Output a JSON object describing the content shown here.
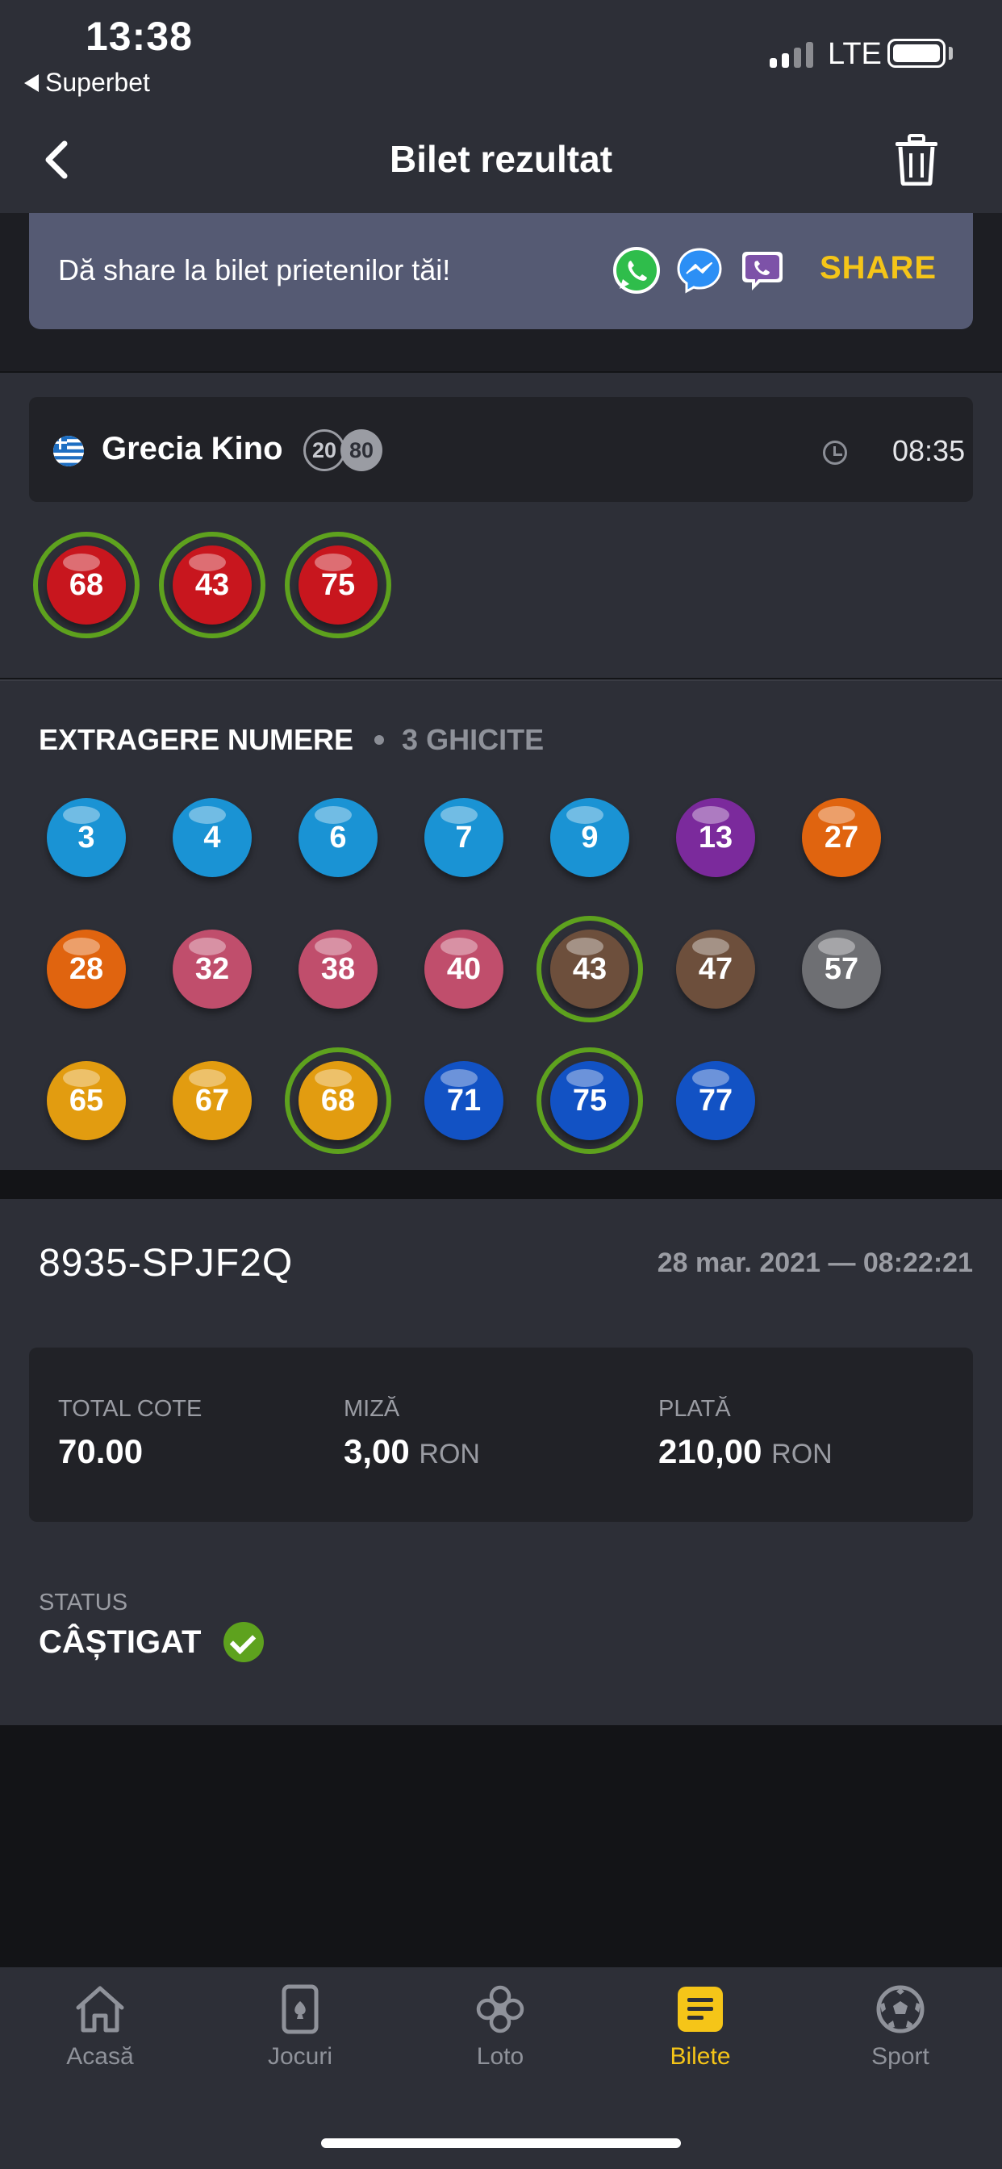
{
  "status_bar": {
    "time": "13:38",
    "back_app": "Superbet",
    "network": "LTE"
  },
  "nav": {
    "title": "Bilet rezultat"
  },
  "share": {
    "text": "Dă share la bilet prietenilor tăi!",
    "button": "SHARE",
    "icons": [
      "whatsapp-icon",
      "messenger-icon",
      "viber-icon"
    ]
  },
  "game": {
    "name": "Grecia Kino",
    "badge_picked": "20",
    "badge_total": "80",
    "time": "08:35"
  },
  "selected_numbers": [
    {
      "n": "68",
      "color": "#c8161e",
      "hit": true
    },
    {
      "n": "43",
      "color": "#c8161e",
      "hit": true
    },
    {
      "n": "75",
      "color": "#c8161e",
      "hit": true
    }
  ],
  "draw": {
    "title": "EXTRAGERE NUMERE",
    "subtitle": "3 GHICITE",
    "numbers": [
      {
        "n": "3",
        "color": "#1a93d4",
        "hit": false
      },
      {
        "n": "4",
        "color": "#1a93d4",
        "hit": false
      },
      {
        "n": "6",
        "color": "#1a93d4",
        "hit": false
      },
      {
        "n": "7",
        "color": "#1a93d4",
        "hit": false
      },
      {
        "n": "9",
        "color": "#1a93d4",
        "hit": false
      },
      {
        "n": "13",
        "color": "#7b2a9c",
        "hit": false
      },
      {
        "n": "27",
        "color": "#e0640f",
        "hit": false
      },
      {
        "n": "28",
        "color": "#e0640f",
        "hit": false
      },
      {
        "n": "32",
        "color": "#c04e6c",
        "hit": false
      },
      {
        "n": "38",
        "color": "#c04e6c",
        "hit": false
      },
      {
        "n": "40",
        "color": "#c04e6c",
        "hit": false
      },
      {
        "n": "43",
        "color": "#6d4f3c",
        "hit": true
      },
      {
        "n": "47",
        "color": "#6d4f3c",
        "hit": false
      },
      {
        "n": "57",
        "color": "#6e6f73",
        "hit": false
      },
      {
        "n": "65",
        "color": "#e29c10",
        "hit": false
      },
      {
        "n": "67",
        "color": "#e29c10",
        "hit": false
      },
      {
        "n": "68",
        "color": "#e29c10",
        "hit": true
      },
      {
        "n": "71",
        "color": "#1252c4",
        "hit": false
      },
      {
        "n": "75",
        "color": "#1252c4",
        "hit": true
      },
      {
        "n": "77",
        "color": "#1252c4",
        "hit": false
      }
    ]
  },
  "ticket": {
    "id": "8935-SPJF2Q",
    "date": "28 mar. 2021 — 08:22:21",
    "total_cote_label": "TOTAL COTE",
    "total_cote_value": "70.00",
    "miza_label": "MIZĂ",
    "miza_value": "3,00",
    "plata_label": "PLATĂ",
    "plata_value": "210,00",
    "currency": "RON",
    "status_label": "STATUS",
    "status_value": "CÂȘTIGAT"
  },
  "tabs": [
    {
      "label": "Acasă",
      "icon": "home-icon",
      "active": false
    },
    {
      "label": "Jocuri",
      "icon": "cards-icon",
      "active": false
    },
    {
      "label": "Loto",
      "icon": "clover-icon",
      "active": false
    },
    {
      "label": "Bilete",
      "icon": "ticket-icon",
      "active": true
    },
    {
      "label": "Sport",
      "icon": "soccer-ball-icon",
      "active": false
    }
  ],
  "colors": {
    "accent": "#f5c518",
    "hit_ring": "#5ea21e",
    "panel": "#2d2f37",
    "card": "#212227"
  }
}
